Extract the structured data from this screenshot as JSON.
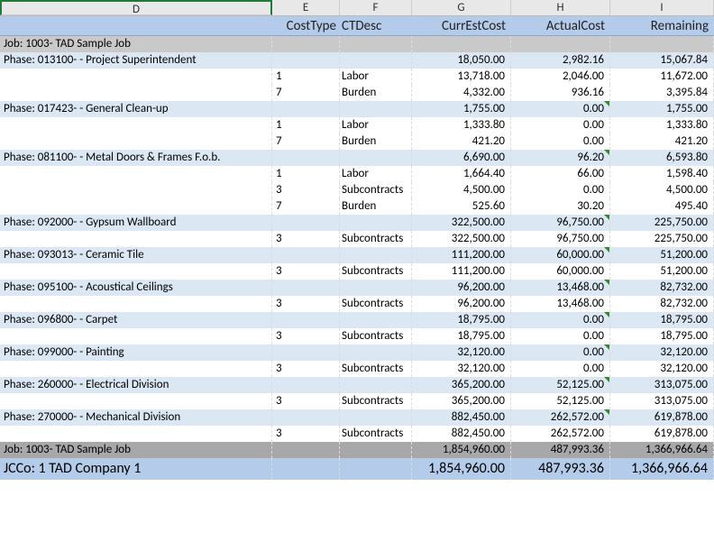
{
  "columns": {
    "letters": [
      "D",
      "E",
      "F",
      "G",
      "H",
      "I"
    ],
    "labels": {
      "D": "",
      "E": "CostType",
      "F": "CTDesc",
      "G": "CurrEstCost",
      "H": "ActualCost",
      "I": "Remaining"
    }
  },
  "job_header": "Job:   1003- TAD Sample Job",
  "phases": [
    {
      "label": "Phase: 013100-   - Project  Superintendent",
      "g": "18,050.00",
      "h": "2,982.16",
      "i": "15,067.84",
      "tri": false,
      "rows": [
        {
          "e": "1",
          "f": "Labor",
          "g": "13,718.00",
          "h": "2,046.00",
          "i": "11,672.00"
        },
        {
          "e": "7",
          "f": "Burden",
          "g": "4,332.00",
          "h": "936.16",
          "i": "3,395.84"
        }
      ]
    },
    {
      "label": "Phase: 017423-   - General Clean-up",
      "g": "1,755.00",
      "h": "0.00",
      "i": "1,755.00",
      "tri": true,
      "rows": [
        {
          "e": "1",
          "f": "Labor",
          "g": "1,333.80",
          "h": "0.00",
          "i": "1,333.80"
        },
        {
          "e": "7",
          "f": "Burden",
          "g": "421.20",
          "h": "0.00",
          "i": "421.20"
        }
      ]
    },
    {
      "label": "Phase: 081100-   - Metal Doors & Frames F.o.b.",
      "g": "6,690.00",
      "h": "96.20",
      "i": "6,593.80",
      "tri": true,
      "rows": [
        {
          "e": "1",
          "f": "Labor",
          "g": "1,664.40",
          "h": "66.00",
          "i": "1,598.40"
        },
        {
          "e": "3",
          "f": "Subcontracts",
          "g": "4,500.00",
          "h": "0.00",
          "i": "4,500.00"
        },
        {
          "e": "7",
          "f": "Burden",
          "g": "525.60",
          "h": "30.20",
          "i": "495.40"
        }
      ]
    },
    {
      "label": "Phase: 092000-   - Gypsum Wallboard",
      "g": "322,500.00",
      "h": "96,750.00",
      "i": "225,750.00",
      "tri": true,
      "rows": [
        {
          "e": "3",
          "f": "Subcontracts",
          "g": "322,500.00",
          "h": "96,750.00",
          "i": "225,750.00"
        }
      ]
    },
    {
      "label": "Phase: 093013-   - Ceramic Tile",
      "g": "111,200.00",
      "h": "60,000.00",
      "i": "51,200.00",
      "tri": true,
      "rows": [
        {
          "e": "3",
          "f": "Subcontracts",
          "g": "111,200.00",
          "h": "60,000.00",
          "i": "51,200.00"
        }
      ]
    },
    {
      "label": "Phase: 095100-   - Acoustical Ceilings",
      "g": "96,200.00",
      "h": "13,468.00",
      "i": "82,732.00",
      "tri": true,
      "rows": [
        {
          "e": "3",
          "f": "Subcontracts",
          "g": "96,200.00",
          "h": "13,468.00",
          "i": "82,732.00"
        }
      ]
    },
    {
      "label": "Phase: 096800-   - Carpet",
      "g": "18,795.00",
      "h": "0.00",
      "i": "18,795.00",
      "tri": true,
      "rows": [
        {
          "e": "3",
          "f": "Subcontracts",
          "g": "18,795.00",
          "h": "0.00",
          "i": "18,795.00"
        }
      ]
    },
    {
      "label": "Phase: 099000-   - Painting",
      "g": "32,120.00",
      "h": "0.00",
      "i": "32,120.00",
      "tri": true,
      "rows": [
        {
          "e": "3",
          "f": "Subcontracts",
          "g": "32,120.00",
          "h": "0.00",
          "i": "32,120.00"
        }
      ]
    },
    {
      "label": "Phase: 260000-   - Electrical Division",
      "g": "365,200.00",
      "h": "52,125.00",
      "i": "313,075.00",
      "tri": true,
      "rows": [
        {
          "e": "3",
          "f": "Subcontracts",
          "g": "365,200.00",
          "h": "52,125.00",
          "i": "313,075.00"
        }
      ]
    },
    {
      "label": "Phase: 270000-   - Mechanical Division",
      "g": "882,450.00",
      "h": "262,572.00",
      "i": "619,878.00",
      "tri": true,
      "rows": [
        {
          "e": "3",
          "f": "Subcontracts",
          "g": "882,450.00",
          "h": "262,572.00",
          "i": "619,878.00"
        }
      ]
    }
  ],
  "job_total": {
    "label": "Job:  1003- TAD Sample Job",
    "g": "1,854,960.00",
    "h": "487,993.36",
    "i": "1,366,966.64"
  },
  "company_total": {
    "label": "JCCo: 1 TAD Company 1",
    "g": "1,854,960.00",
    "h": "487,993.36",
    "i": "1,366,966.64"
  }
}
